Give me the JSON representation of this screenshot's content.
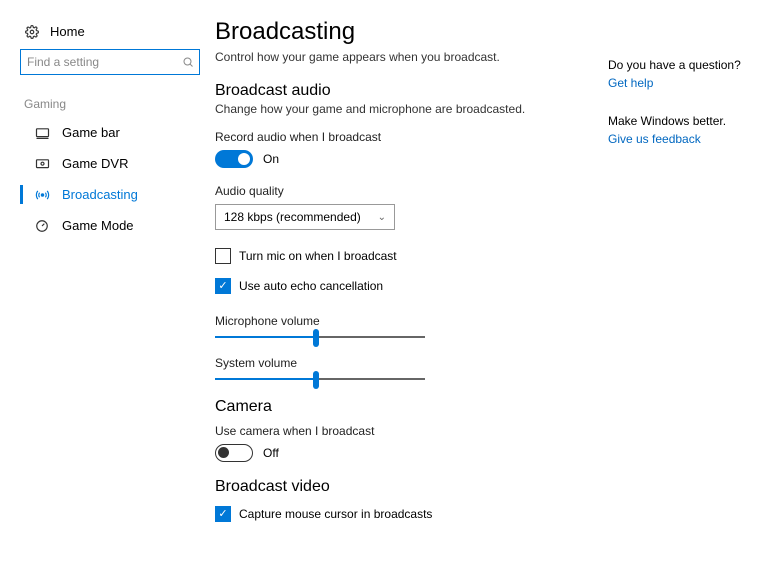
{
  "sidebar": {
    "home": "Home",
    "search_placeholder": "Find a setting",
    "section": "Gaming",
    "items": [
      {
        "label": "Game bar"
      },
      {
        "label": "Game DVR"
      },
      {
        "label": "Broadcasting"
      },
      {
        "label": "Game Mode"
      }
    ]
  },
  "main": {
    "title": "Broadcasting",
    "subtitle": "Control how your game appears when you broadcast.",
    "audio": {
      "heading": "Broadcast audio",
      "desc": "Change how your game and microphone are broadcasted.",
      "record_label": "Record audio when I broadcast",
      "record_state": "On",
      "quality_label": "Audio quality",
      "quality_value": "128 kbps (recommended)",
      "mic_label": "Turn mic on when I broadcast",
      "echo_label": "Use auto echo cancellation",
      "mic_vol_label": "Microphone volume",
      "sys_vol_label": "System volume"
    },
    "camera": {
      "heading": "Camera",
      "use_label": "Use camera when I broadcast",
      "use_state": "Off"
    },
    "video": {
      "heading": "Broadcast video",
      "cursor_label": "Capture mouse cursor in broadcasts"
    }
  },
  "right": {
    "question": "Do you have a question?",
    "help": "Get help",
    "better": "Make Windows better.",
    "feedback": "Give us feedback"
  }
}
